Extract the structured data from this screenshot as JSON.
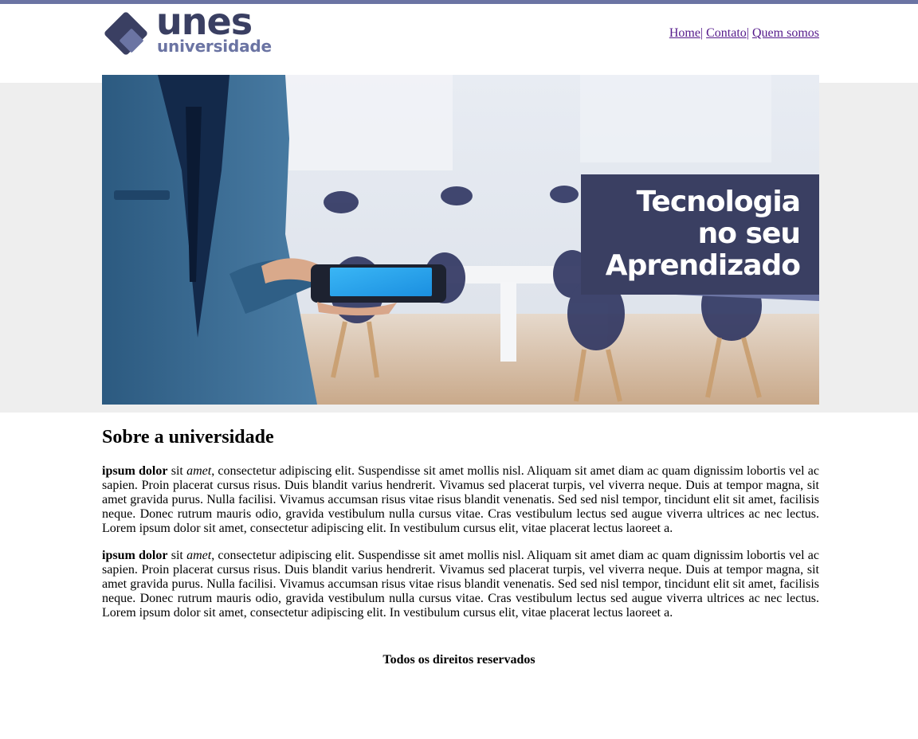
{
  "colors": {
    "accent": "#6b74a3",
    "brand_dark": "#3a3f62",
    "band": "#eeeeee",
    "link": "#551a8b"
  },
  "brand": {
    "word": "unes",
    "sub": "universidade"
  },
  "nav": {
    "items": [
      "Home",
      "Contato",
      "Quem somos"
    ],
    "separator": "|"
  },
  "hero": {
    "line1": "Tecnologia",
    "line2": "no seu",
    "line3": "Aprendizado"
  },
  "main": {
    "heading": "Sobre a universidade",
    "paragraphs": [
      {
        "bold": "ipsum dolor",
        "t1": " sit ",
        "em": "amet",
        "t2": ", consectetur adipiscing elit. Suspendisse sit amet mollis nisl. Aliquam sit amet diam ac quam dignissim lobortis vel ac sapien. Proin placerat cursus risus. Duis blandit varius hendrerit. Vivamus sed placerat turpis, vel viverra neque. Duis at tempor magna, sit amet gravida purus. Nulla facilisi. Vivamus accumsan risus vitae risus blandit venenatis. Sed sed nisl tempor, tincidunt elit sit amet, facilisis neque. Donec rutrum mauris odio, gravida vestibulum nulla cursus vitae. Cras vestibulum lectus sed augue viverra ultrices ac nec lectus. Lorem ipsum dolor sit amet, consectetur adipiscing elit. In vestibulum cursus elit, vitae placerat lectus laoreet a."
      },
      {
        "bold": "ipsum dolor",
        "t1": " sit ",
        "em": "amet",
        "t2": ", consectetur adipiscing elit. Suspendisse sit amet mollis nisl. Aliquam sit amet diam ac quam dignissim lobortis vel ac sapien. Proin placerat cursus risus. Duis blandit varius hendrerit. Vivamus sed placerat turpis, vel viverra neque. Duis at tempor magna, sit amet gravida purus. Nulla facilisi. Vivamus accumsan risus vitae risus blandit venenatis. Sed sed nisl tempor, tincidunt elit sit amet, facilisis neque. Donec rutrum mauris odio, gravida vestibulum nulla cursus vitae. Cras vestibulum lectus sed augue viverra ultrices ac nec lectus. Lorem ipsum dolor sit amet, consectetur adipiscing elit. In vestibulum cursus elit, vitae placerat lectus laoreet a."
      }
    ]
  },
  "footer": {
    "text": "Todos os direitos reservados"
  }
}
